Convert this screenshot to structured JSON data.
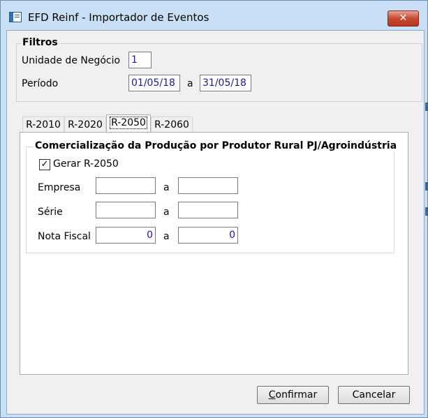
{
  "window": {
    "title": "EFD Reinf - Importador de Eventos",
    "close_glyph": "✕"
  },
  "filtros": {
    "group_title": "Filtros",
    "unidade_label": "Unidade de Negócio",
    "unidade_value": "1",
    "periodo_label": "Período",
    "periodo_start": "01/05/18",
    "periodo_sep": "a",
    "periodo_end": "31/05/18"
  },
  "tabs": [
    {
      "label": "R-2010"
    },
    {
      "label": "R-2020"
    },
    {
      "label": "R-2050"
    },
    {
      "label": "R-2060"
    }
  ],
  "active_tab": "R-2050",
  "r2050": {
    "group_title": "Comercialização da Produção por Produtor Rural PJ/Agroindústria",
    "checkbox_label": "Gerar R-2050",
    "checkbox_checked": true,
    "check_glyph": "✓",
    "empresa_label": "Empresa",
    "empresa_from": "",
    "empresa_sep": "a",
    "empresa_to": "",
    "serie_label": "Série",
    "serie_from": "",
    "serie_sep": "a",
    "serie_to": "",
    "nota_label": "Nota Fiscal",
    "nota_from": "0",
    "nota_sep": "a",
    "nota_to": "0"
  },
  "buttons": {
    "confirmar_mnemonic": "C",
    "confirmar_rest": "onfirmar",
    "cancelar_label": "Cancelar"
  },
  "colors": {
    "title_bg": "#c9dff5",
    "close_red": "#c9492f",
    "field_text": "#1a1a9c"
  }
}
